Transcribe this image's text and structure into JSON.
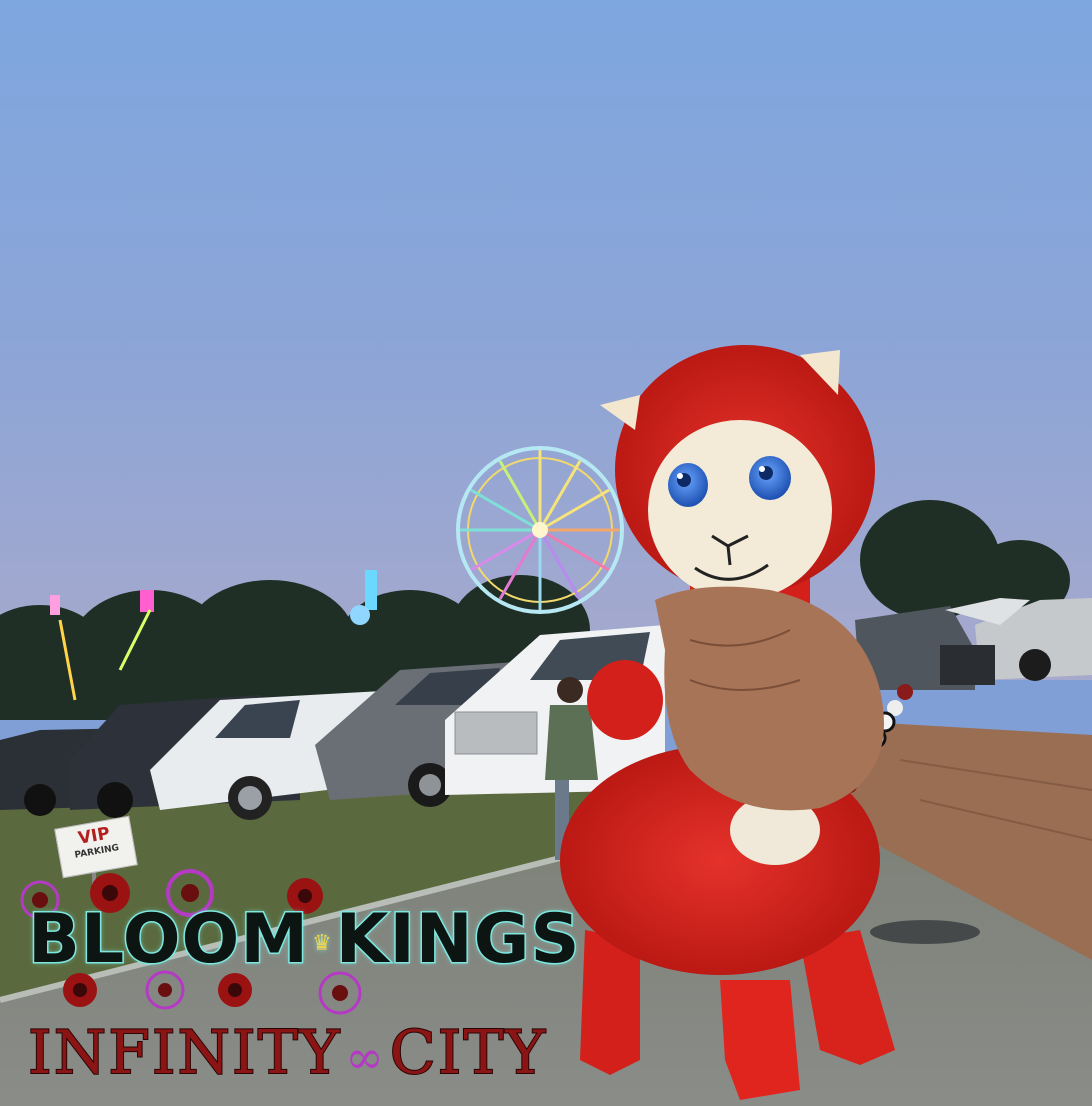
{
  "image": {
    "caption_main_left": "BLOOM",
    "caption_main_right": "KINGS",
    "caption_sub_left": "INFINITY",
    "caption_sub_right": "CITY",
    "crown_glyph": "♛",
    "infinity_glyph": "∞",
    "sign_line1": "VIP",
    "sign_line2": "PARKING",
    "colors": {
      "sky_top": "#7fa7e0",
      "sky_bottom": "#9aa5cf",
      "plush_red": "#d41e1b",
      "plush_face": "#f1ead4",
      "eye_blue": "#2a64c8",
      "caption_outline": "#7de8e0",
      "caption_sub": "#8b1515",
      "flower_red": "#9b1212",
      "flower_purple": "#b43ac4"
    }
  }
}
